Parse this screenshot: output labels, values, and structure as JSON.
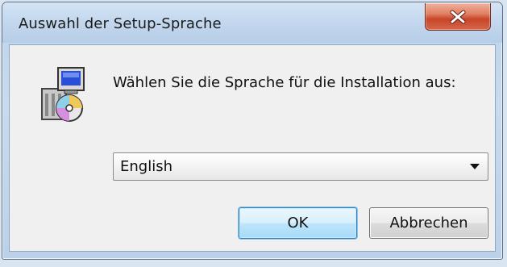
{
  "window": {
    "title": "Auswahl der Setup-Sprache",
    "close_icon": "close-x-icon"
  },
  "dialog": {
    "icon": "setup-installer-icon",
    "prompt": "Wählen Sie die Sprache für die Installation aus:",
    "language_select": {
      "selected": "English",
      "arrow_icon": "dropdown-arrow-icon"
    },
    "buttons": {
      "ok_label": "OK",
      "cancel_label": "Abbrechen"
    }
  },
  "colors": {
    "close_button": "#c8452a",
    "default_button_border": "#3c7fb1",
    "window_frame": "#bcd1e8"
  }
}
